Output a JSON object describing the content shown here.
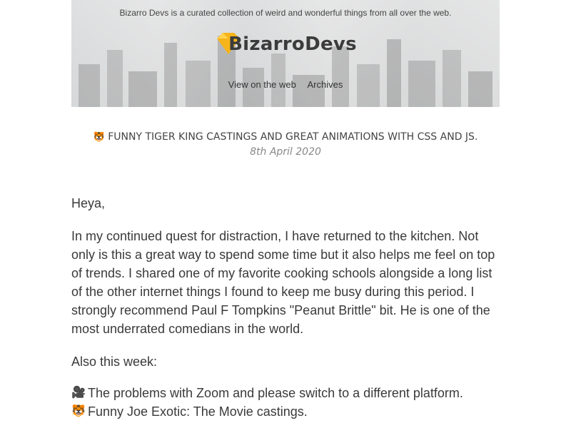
{
  "header": {
    "tagline": "Bizarro Devs is a curated collection of weird and wonderful things from all over the web.",
    "logo_text": "BizarroDevs",
    "nav": [
      {
        "label": "View on the web"
      },
      {
        "label": "Archives"
      }
    ]
  },
  "subject": {
    "emoji": "🐯",
    "title": "FUNNY TIGER KING CASTINGS AND GREAT ANIMATIONS WITH CSS AND JS.",
    "date": "8th April 2020"
  },
  "body": {
    "greeting": "Heya,",
    "intro": "In my continued quest for distraction, I have returned to the kitchen. Not only is this a great way to spend some time but it also helps me feel on top of trends. I shared one of my favorite cooking schools alongside a long list of the other internet things I found to keep me busy during this period. I strongly recommend Paul F Tompkins \"Peanut Brittle\" bit. He is one of the most underrated comedians in the world.",
    "also_heading": "Also this week:",
    "items": [
      {
        "icon": "🎥",
        "text": "The problems with Zoom and please switch to a different platform."
      },
      {
        "icon": "🐯",
        "text": "Funny Joe Exotic: The Movie castings."
      }
    ]
  },
  "colors": {
    "logo_accent": "#f5b41a",
    "text": "#3a3a3a",
    "muted": "#888888"
  }
}
